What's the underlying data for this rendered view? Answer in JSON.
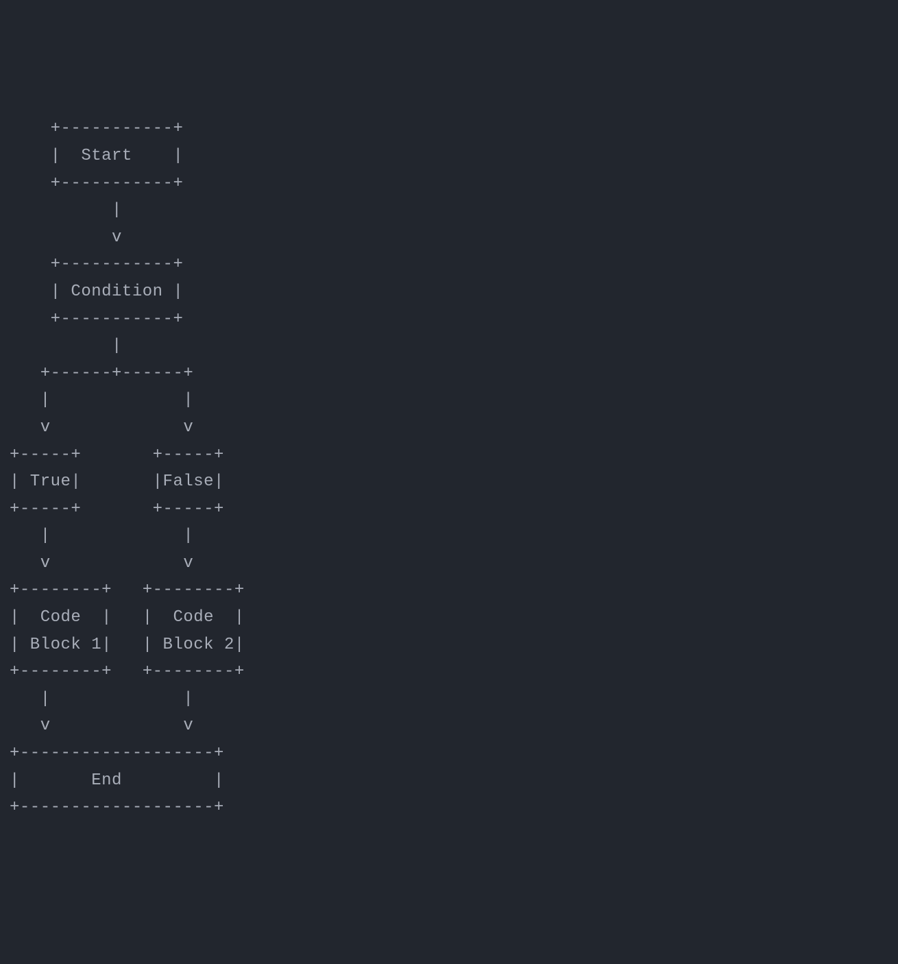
{
  "ascii_diagram": {
    "lines": [
      "    +-----------+",
      "    |  Start    |",
      "    +-----------+",
      "          |",
      "          v",
      "    +-----------+",
      "    | Condition |",
      "    +-----------+",
      "          |",
      "   +------+------+",
      "   |             |",
      "   v             v",
      "+-----+       +-----+",
      "| True|       |False|",
      "+-----+       +-----+",
      "   |             |",
      "   v             v",
      "+--------+   +--------+",
      "|  Code  |   |  Code  |",
      "| Block 1|   | Block 2|",
      "+--------+   +--------+",
      "   |             |",
      "   v             v",
      "+-------------------+",
      "|       End         |",
      "+-------------------+"
    ]
  },
  "flowchart": {
    "nodes": {
      "start": "Start",
      "condition": "Condition",
      "true_branch": "True",
      "false_branch": "False",
      "code_block_1": "Code Block 1",
      "code_block_2": "Code Block 2",
      "end": "End"
    }
  }
}
